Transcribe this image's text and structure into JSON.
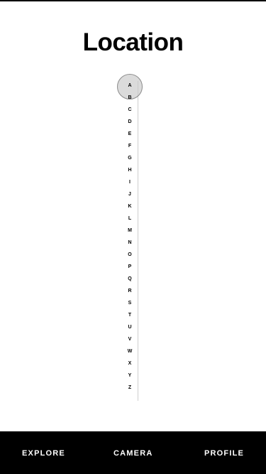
{
  "page": {
    "title": "Location"
  },
  "alpha_index": {
    "letters": [
      "A",
      "B",
      "C",
      "D",
      "E",
      "F",
      "G",
      "H",
      "I",
      "J",
      "K",
      "L",
      "M",
      "N",
      "O",
      "P",
      "Q",
      "R",
      "S",
      "T",
      "U",
      "V",
      "W",
      "X",
      "Y",
      "Z"
    ],
    "selected": "A"
  },
  "bottom_nav": {
    "items": [
      {
        "label": "EXPLORE"
      },
      {
        "label": "CAMERA"
      },
      {
        "label": "PROFILE"
      }
    ]
  }
}
